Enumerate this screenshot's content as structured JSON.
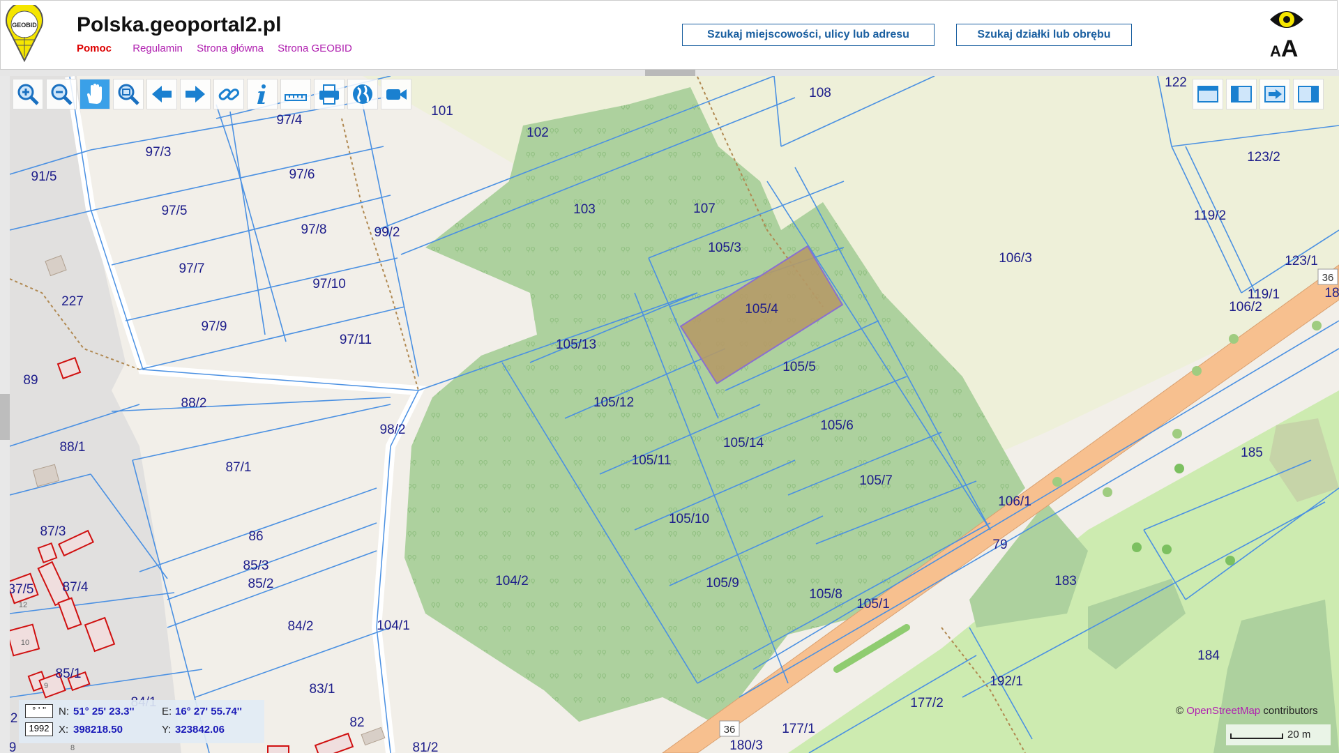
{
  "header": {
    "logo_text": "GEOBID",
    "title": "Polska.geoportal2.pl",
    "nav": [
      "Pomoc",
      "Regulamin",
      "Strona główna",
      "Strona GEOBID"
    ],
    "search_address": "Szukaj miejscowości, ulicy lub adresu",
    "search_parcel": "Szukaj działki lub obrębu",
    "font_small": "A",
    "font_big": "A"
  },
  "toolbar": {
    "tools": [
      "zoom-in-icon",
      "zoom-out-icon",
      "hand-icon",
      "zoom-box-icon",
      "back-arrow-icon",
      "forward-arrow-icon",
      "link-icon",
      "info-icon",
      "measure-icon",
      "print-icon",
      "globe-icon",
      "video-camera-icon"
    ],
    "active": "hand-icon",
    "right_tools": [
      "panel-top-icon",
      "panel-left-icon",
      "panel-export-icon",
      "panel-right-icon"
    ]
  },
  "map": {
    "parcels": [
      "101",
      "102",
      "103",
      "107",
      "108",
      "122",
      "123/2",
      "119/2",
      "123/1",
      "119/1",
      "106/2",
      "106/3",
      "105/3",
      "105/4",
      "105/5",
      "105/6",
      "105/7",
      "105/13",
      "105/12",
      "105/11",
      "105/10",
      "105/14",
      "105/9",
      "105/8",
      "105/1",
      "106/1",
      "104/2",
      "104/1",
      "97/4",
      "97/3",
      "97/6",
      "97/5",
      "97/8",
      "97/7",
      "97/10",
      "97/9",
      "97/11",
      "99/2",
      "91/5",
      "227",
      "89",
      "88/2",
      "88/1",
      "98/2",
      "87/1",
      "87/3",
      "86",
      "85/3",
      "85/2",
      "87/4",
      "84/2",
      "85/1",
      "84/1",
      "83/1",
      "82",
      "81/2",
      "79",
      "183",
      "185",
      "184",
      "192/1",
      "177/2",
      "177/1",
      "180/3",
      "18",
      "37/5",
      "2",
      "9"
    ],
    "road_numbers": [
      "36",
      "36"
    ],
    "building_numbers": [
      "12",
      "10",
      "9",
      "8"
    ],
    "selected_parcel": "105/4"
  },
  "coordinates": {
    "dms_button": "° ' ''",
    "system_button": "1992",
    "n_label": "N:",
    "n_value": "51° 25' 23.3''",
    "e_label": "E:",
    "e_value": "16° 27' 55.74''",
    "x_label": "X:",
    "x_value": "398218.50",
    "y_label": "Y:",
    "y_value": "323842.06"
  },
  "attribution": {
    "prefix": "©",
    "osm": "OpenStreetMap",
    "suffix": "contributors"
  },
  "scale": "20 m",
  "colors": {
    "forest": "#add19e",
    "selected": "#b59a67",
    "road": "#f7c08f",
    "parcel_line": "#4a90e2",
    "label": "#1c1c8a",
    "building": "#d01010"
  }
}
